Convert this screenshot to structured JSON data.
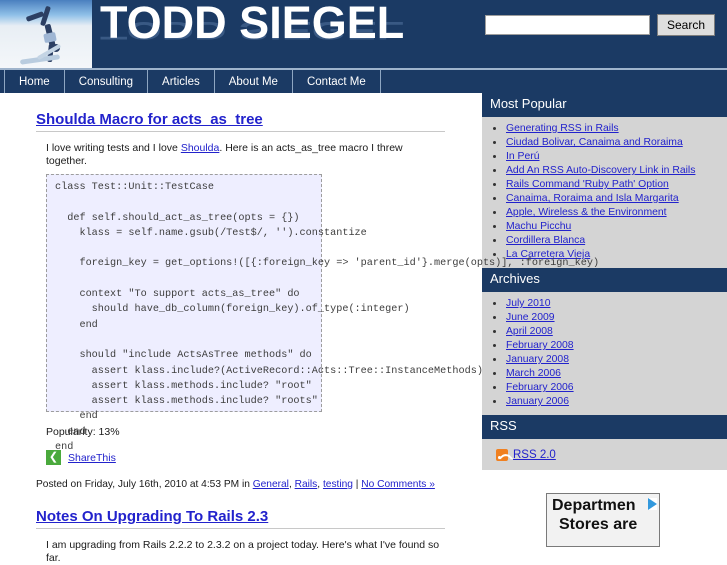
{
  "site": {
    "title": "TODD SIEGEL",
    "banner_bg": "#1b3a64",
    "accent_link": "#2222cc"
  },
  "search": {
    "value": "",
    "placeholder": "",
    "button_label": "Search"
  },
  "nav": {
    "items": [
      {
        "label": "Home"
      },
      {
        "label": "Consulting"
      },
      {
        "label": "Articles"
      },
      {
        "label": "About Me"
      },
      {
        "label": "Contact Me"
      }
    ]
  },
  "posts": [
    {
      "title": "Shoulda Macro for acts_as_tree",
      "intro_before": "I love writing tests and I love ",
      "intro_link": "Shoulda",
      "intro_after": ".  Here is an acts_as_tree macro I threw together.",
      "code": "class Test::Unit::TestCase\n\n  def self.should_act_as_tree(opts = {})\n    klass = self.name.gsub(/Test$/, '').constantize\n\n    foreign_key = get_options!([{:foreign_key => 'parent_id'}.merge(opts)], :foreign_key)\n\n    context \"To support acts_as_tree\" do\n      should have_db_column(foreign_key).of_type(:integer)\n    end\n\n    should \"include ActsAsTree methods\" do\n      assert klass.include?(ActiveRecord::Acts::Tree::InstanceMethods)\n      assert klass.methods.include? \"root\"\n      assert klass.methods.include? \"roots\"\n    end\n  end\nend",
      "popularity": "Popularity: 13%",
      "share_label": "ShareThis",
      "share_icon": "share-icon",
      "meta_prefix": "Posted on Friday, July 16th, 2010 at 4:53 PM in ",
      "meta_categories": [
        "General",
        "Rails",
        "testing"
      ],
      "meta_separator": " | ",
      "meta_comments": "No Comments »"
    },
    {
      "title": "Notes On Upgrading To Rails 2.3",
      "intro": "I am upgrading from Rails 2.2.2 to 2.3.2 on a project today.  Here's what I've found so far."
    }
  ],
  "sidebar": {
    "widgets": [
      {
        "heading": "Most Popular",
        "items": [
          "Generating RSS in Rails",
          "Ciudad Bolivar, Canaima and Roraima",
          "In Perú",
          "Add An RSS Auto-Discovery Link in Rails",
          "Rails Command 'Ruby Path' Option",
          "Canaima, Roraima and Isla Margarita",
          "Apple, Wireless & the Environment",
          "Machu Picchu",
          "Cordillera Blanca",
          "La Carretera Vieja"
        ]
      },
      {
        "heading": "Archives",
        "items": [
          "July 2010",
          "June 2009",
          "April 2008",
          "February 2008",
          "January 2008",
          "March 2006",
          "February 2006",
          "January 2006"
        ]
      },
      {
        "heading": "RSS",
        "rss_label": "RSS 2.0",
        "rss_icon": "rss-icon"
      }
    ]
  },
  "ad": {
    "line1": "Departmen",
    "line2": "Stores are"
  }
}
